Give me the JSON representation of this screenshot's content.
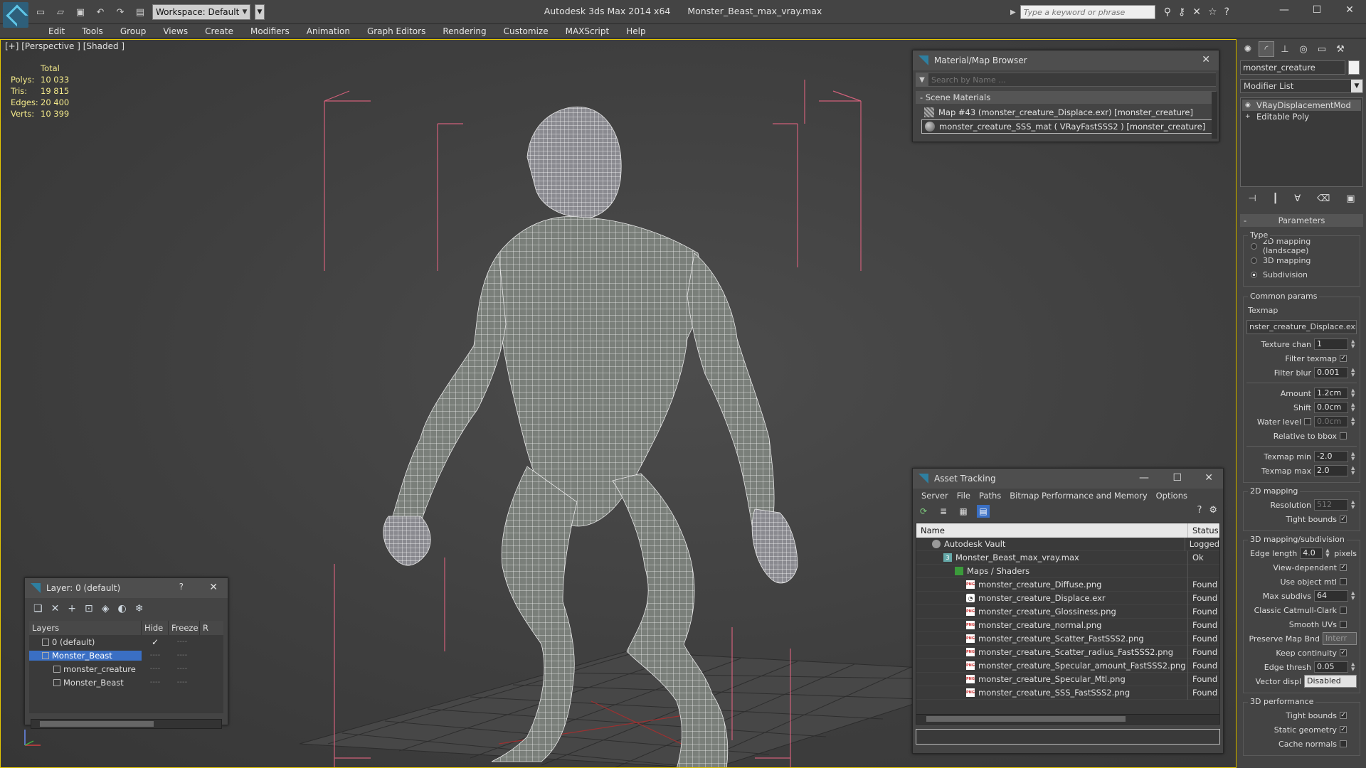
{
  "titlebar": {
    "app_title": "Autodesk 3ds Max  2014 x64",
    "file_title": "Monster_Beast_max_vray.max",
    "workspace_label": "Workspace: Default",
    "search_placeholder": "Type a keyword or phrase"
  },
  "menu": [
    "Edit",
    "Tools",
    "Group",
    "Views",
    "Create",
    "Modifiers",
    "Animation",
    "Graph Editors",
    "Rendering",
    "Customize",
    "MAXScript",
    "Help"
  ],
  "viewport": {
    "label": "[+] [Perspective ] [Shaded ]",
    "stats_header": "Total",
    "stats": [
      {
        "label": "Polys:",
        "value": "10 033"
      },
      {
        "label": "Tris:",
        "value": "19 815"
      },
      {
        "label": "Edges:",
        "value": "20 400"
      },
      {
        "label": "Verts:",
        "value": "10 399"
      }
    ]
  },
  "material_browser": {
    "title": "Material/Map Browser",
    "search_placeholder": "Search by Name ...",
    "group": "Scene Materials",
    "items": [
      "Map #43 (monster_creature_Displace.exr)  [monster_creature]",
      "monster_creature_SSS_mat  ( VRayFastSSS2 )  [monster_creature]"
    ]
  },
  "layer_panel": {
    "title": "Layer: 0 (default)",
    "help": "?",
    "columns": [
      "Layers",
      "Hide",
      "Freeze",
      "R"
    ],
    "rows": [
      {
        "name": "0 (default)",
        "indent": 0,
        "hide": "✓",
        "freeze": "----"
      },
      {
        "name": "Monster_Beast",
        "indent": 0,
        "hide": "----",
        "freeze": "----"
      },
      {
        "name": "monster_creature",
        "indent": 1,
        "hide": "----",
        "freeze": "----"
      },
      {
        "name": "Monster_Beast",
        "indent": 1,
        "hide": "----",
        "freeze": "----"
      }
    ]
  },
  "asset_tracking": {
    "title": "Asset Tracking",
    "menu": [
      "Server",
      "File",
      "Paths",
      "Bitmap Performance and Memory",
      "Options"
    ],
    "columns": [
      "Name",
      "Status"
    ],
    "rows": [
      {
        "name": "Autodesk Vault",
        "status": "Logged",
        "indent": 1,
        "icon": "vault"
      },
      {
        "name": "Monster_Beast_max_vray.max",
        "status": "Ok",
        "indent": 2,
        "icon": "maxfile"
      },
      {
        "name": "Maps / Shaders",
        "status": "",
        "indent": 3,
        "icon": "folder"
      },
      {
        "name": "monster_creature_Diffuse.png",
        "status": "Found",
        "indent": 4,
        "icon": "png"
      },
      {
        "name": "monster_creature_Displace.exr",
        "status": "Found",
        "indent": 4,
        "icon": "exr"
      },
      {
        "name": "monster_creature_Glossiness.png",
        "status": "Found",
        "indent": 4,
        "icon": "png"
      },
      {
        "name": "monster_creature_normal.png",
        "status": "Found",
        "indent": 4,
        "icon": "png"
      },
      {
        "name": "monster_creature_Scatter_FastSSS2.png",
        "status": "Found",
        "indent": 4,
        "icon": "png"
      },
      {
        "name": "monster_creature_Scatter_radius_FastSSS2.png",
        "status": "Found",
        "indent": 4,
        "icon": "png"
      },
      {
        "name": "monster_creature_Specular_amount_FastSSS2.png",
        "status": "Found",
        "indent": 4,
        "icon": "png"
      },
      {
        "name": "monster_creature_Specular_Mtl.png",
        "status": "Found",
        "indent": 4,
        "icon": "png"
      },
      {
        "name": "monster_creature_SSS_FastSSS2.png",
        "status": "Found",
        "indent": 4,
        "icon": "png"
      }
    ]
  },
  "command_panel": {
    "object_name": "monster_creature",
    "modifier_list": "Modifier List",
    "stack": [
      "VRayDisplacementMod",
      "Editable Poly"
    ],
    "rollout": "Parameters",
    "type_group": "Type",
    "type_options": [
      "2D mapping (landscape)",
      "3D mapping",
      "Subdivision"
    ],
    "common_group": "Common params",
    "texmap_label": "Texmap",
    "texmap_value": "nster_creature_Displace.exr)",
    "texture_chan": {
      "label": "Texture chan",
      "value": "1"
    },
    "filter_texmap": "Filter texmap",
    "filter_blur": {
      "label": "Filter blur",
      "value": "0.001"
    },
    "amount": {
      "label": "Amount",
      "value": "1.2cm"
    },
    "shift": {
      "label": "Shift",
      "value": "0.0cm"
    },
    "water_level": {
      "label": "Water level",
      "value": "0.0cm"
    },
    "relative_bbox": "Relative to bbox",
    "texmap_min": {
      "label": "Texmap min",
      "value": "-2.0"
    },
    "texmap_max": {
      "label": "Texmap max",
      "value": "2.0"
    },
    "mapping2d_group": "2D mapping",
    "resolution": {
      "label": "Resolution",
      "value": "512"
    },
    "tight_bounds": "Tight bounds",
    "subdiv_group": "3D mapping/subdivision",
    "edge_length": {
      "label": "Edge length",
      "value": "4.0",
      "unit": "pixels"
    },
    "view_dependent": "View-dependent",
    "use_object_mtl": "Use object mtl",
    "max_subdivs": {
      "label": "Max subdivs",
      "value": "64"
    },
    "classic_catmull": "Classic Catmull-Clark",
    "smooth_uvs": "Smooth UVs",
    "preserve_map_bnd": {
      "label": "Preserve Map Bnd",
      "value": "Interr"
    },
    "keep_continuity": "Keep continuity",
    "edge_thresh": {
      "label": "Edge thresh",
      "value": "0.05"
    },
    "vector_displ": {
      "label": "Vector displ",
      "value": "Disabled"
    },
    "perf_group": "3D performance",
    "perf_tight_bounds": "Tight bounds",
    "static_geometry": "Static geometry",
    "cache_normals": "Cache normals"
  },
  "colors": {
    "viewport_border": "#e6c800",
    "stats_text": "#f3e98a",
    "selection_blue": "#3a6fc4",
    "bbox_pink": "#d0607a"
  }
}
